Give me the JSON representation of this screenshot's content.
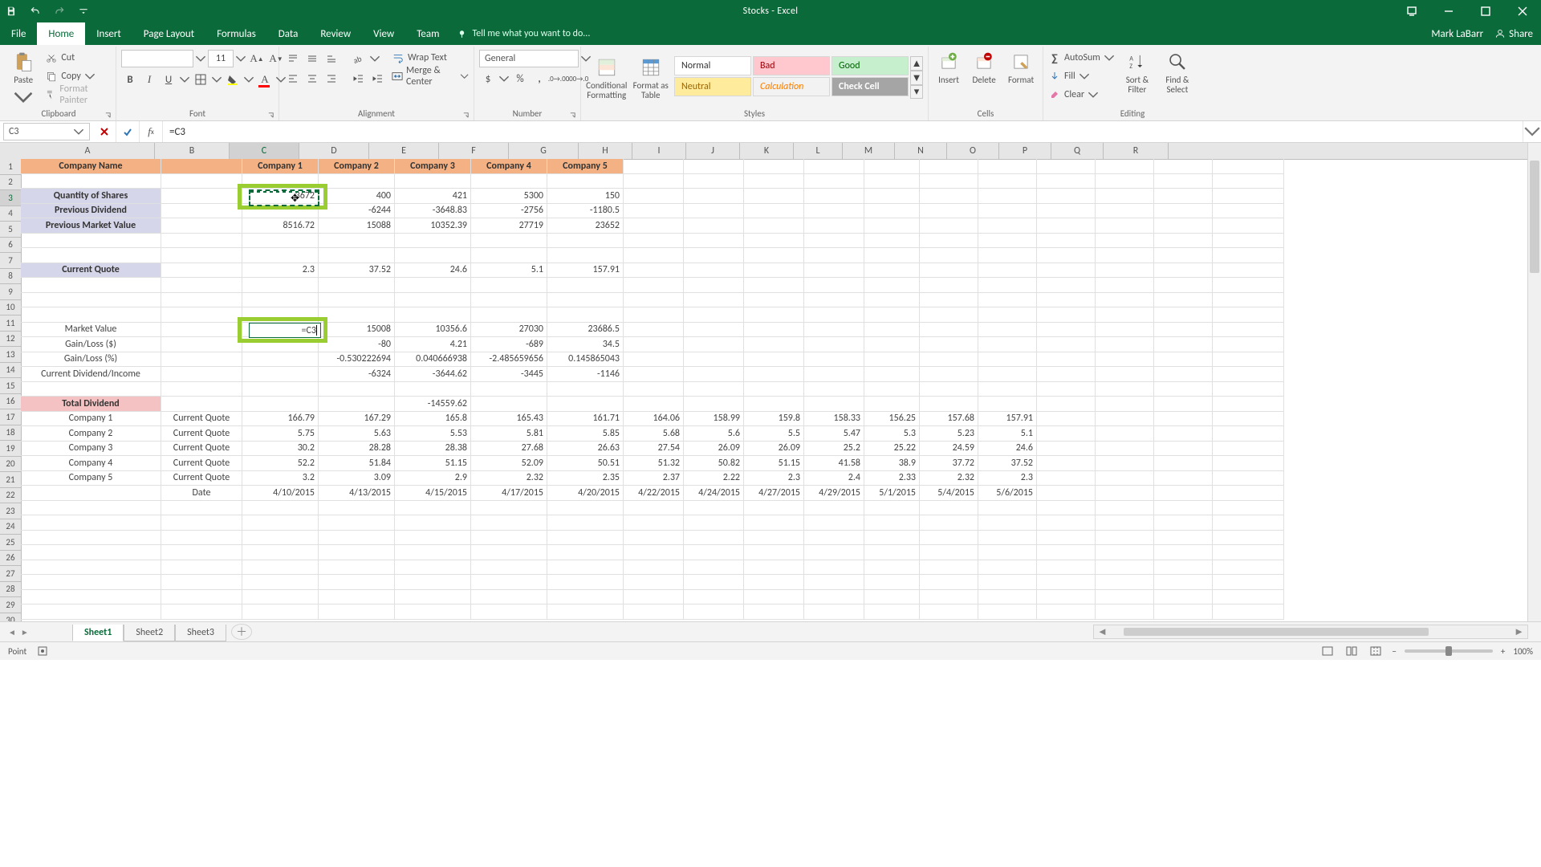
{
  "titlebar": {
    "title": "Stocks - Excel"
  },
  "tabs": {
    "file": "File",
    "home": "Home",
    "insert": "Insert",
    "page_layout": "Page Layout",
    "formulas": "Formulas",
    "data": "Data",
    "review": "Review",
    "view": "View",
    "team": "Team",
    "tell_me": "Tell me what you want to do...",
    "user": "Mark LaBarr",
    "share": "Share"
  },
  "ribbon": {
    "clipboard": {
      "paste": "Paste",
      "cut": "Cut",
      "copy": "Copy",
      "format_painter": "Format Painter",
      "label": "Clipboard"
    },
    "font": {
      "name": "",
      "size": "11",
      "label": "Font"
    },
    "alignment": {
      "wrap": "Wrap Text",
      "merge": "Merge & Center",
      "label": "Alignment"
    },
    "number": {
      "format": "General",
      "label": "Number"
    },
    "cond_fmt": "Conditional Formatting",
    "fmt_table": "Format as Table",
    "styles": {
      "normal": "Normal",
      "bad": "Bad",
      "good": "Good",
      "neutral": "Neutral",
      "calc": "Calculation",
      "check": "Check Cell",
      "label": "Styles"
    },
    "cells": {
      "insert": "Insert",
      "delete": "Delete",
      "format": "Format",
      "label": "Cells"
    },
    "editing": {
      "autosum": "AutoSum",
      "fill": "Fill",
      "clear": "Clear",
      "sort": "Sort & Filter",
      "find": "Find & Select",
      "label": "Editing"
    }
  },
  "formula_bar": {
    "ref": "C3",
    "formula": "=C3"
  },
  "columns": [
    "A",
    "B",
    "C",
    "D",
    "E",
    "F",
    "G",
    "H",
    "I",
    "J",
    "K",
    "L",
    "M",
    "N",
    "O",
    "P",
    "Q",
    "R"
  ],
  "col_classes": [
    "cA",
    "cB",
    "cC",
    "cD",
    "cE",
    "cF",
    "cG",
    "cH",
    "cI",
    "cJ",
    "cK",
    "cL",
    "cM",
    "cN",
    "cO",
    "cP",
    "cQ",
    "cR"
  ],
  "rows_count": 31,
  "selected_col_index": 2,
  "selected_row": 3,
  "sheet": {
    "row1_headers": [
      "Company Name",
      "",
      "Company 1",
      "Company 2",
      "Company 3",
      "Company 4",
      "Company 5"
    ],
    "rowlabels": {
      "r3": "Quantity of Shares",
      "r4": "Previous Dividend",
      "r5": "Previous Market Value",
      "r8": "Current Quote",
      "r12": "Market Value",
      "r13": "Gain/Loss ($)",
      "r14": "Gain/Loss (%)",
      "r15": "Current Dividend/Income",
      "r17": "Total Dividend"
    },
    "r3": [
      "3672",
      "400",
      "421",
      "5300",
      "150"
    ],
    "r4": [
      "",
      "-6244",
      "-3648.83",
      "-2756",
      "-1180.5"
    ],
    "r5": [
      "8516.72",
      "15088",
      "10352.39",
      "27719",
      "23652"
    ],
    "r8": [
      "2.3",
      "37.52",
      "24.6",
      "5.1",
      "157.91"
    ],
    "r12": [
      "=C3",
      "15008",
      "10356.6",
      "27030",
      "23686.5"
    ],
    "r13": [
      "",
      "-80",
      "4.21",
      "-689",
      "34.5"
    ],
    "r14": [
      "",
      "-0.530222694",
      "0.040666938",
      "-2.485659656",
      "0.145865043"
    ],
    "r15": [
      "",
      "-6324",
      "-3644.62",
      "-3445",
      "-1146"
    ],
    "r17_E": "-14559.62",
    "r18": [
      "Company 1",
      "Current Quote",
      "166.79",
      "167.29",
      "165.8",
      "165.43",
      "161.71",
      "164.06",
      "158.99",
      "159.8",
      "158.33",
      "156.25",
      "157.68",
      "157.91"
    ],
    "r19": [
      "Company 2",
      "Current Quote",
      "5.75",
      "5.63",
      "5.53",
      "5.81",
      "5.85",
      "5.68",
      "5.6",
      "5.5",
      "5.47",
      "5.3",
      "5.23",
      "5.1"
    ],
    "r20": [
      "Company 3",
      "Current Quote",
      "30.2",
      "28.28",
      "28.38",
      "27.68",
      "26.63",
      "27.54",
      "26.09",
      "26.09",
      "25.2",
      "25.22",
      "24.59",
      "24.6"
    ],
    "r21": [
      "Company 4",
      "Current Quote",
      "52.2",
      "51.84",
      "51.15",
      "52.09",
      "50.51",
      "51.32",
      "50.82",
      "51.15",
      "41.58",
      "38.9",
      "37.72",
      "37.52"
    ],
    "r22": [
      "Company 5",
      "Current Quote",
      "3.2",
      "3.09",
      "2.9",
      "2.32",
      "2.35",
      "2.37",
      "2.22",
      "2.3",
      "2.4",
      "2.33",
      "2.32",
      "2.3"
    ],
    "r23": [
      "",
      "Date",
      "4/10/2015",
      "4/13/2015",
      "4/15/2015",
      "4/17/2015",
      "4/20/2015",
      "4/22/2015",
      "4/24/2015",
      "4/27/2015",
      "4/29/2015",
      "5/1/2015",
      "5/4/2015",
      "5/6/2015"
    ]
  },
  "sheet_tabs": [
    "Sheet1",
    "Sheet2",
    "Sheet3"
  ],
  "status": {
    "mode": "Point",
    "zoom": "100%"
  }
}
